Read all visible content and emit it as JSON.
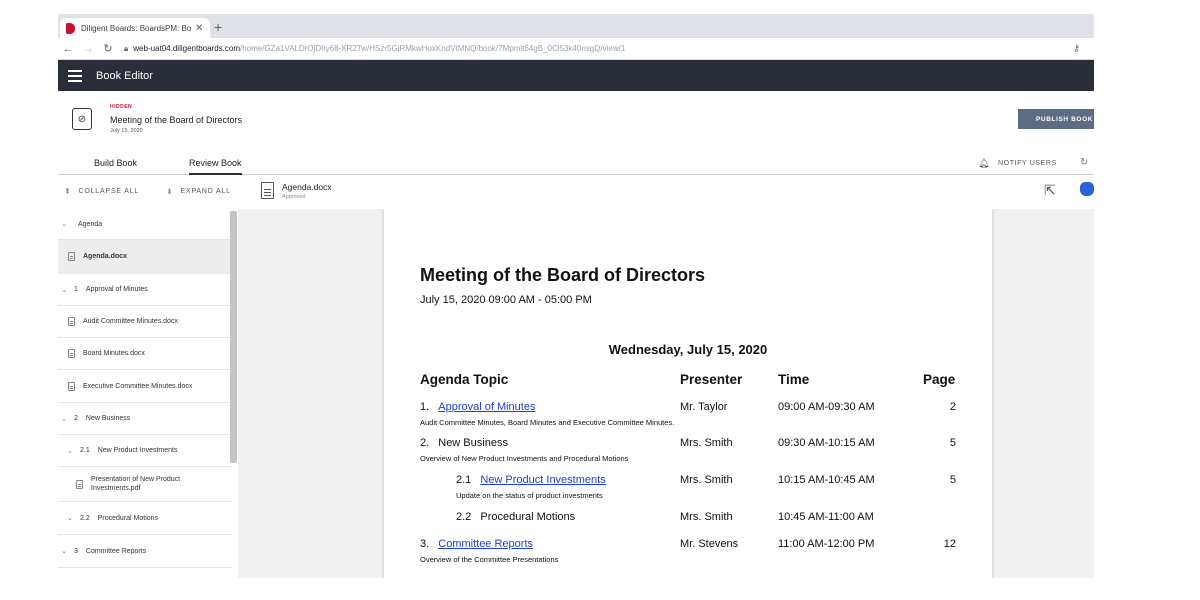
{
  "browser": {
    "tab_title": "Diligent Boards: BoardsPM: Book",
    "url_host": "web-uat04.diligentboards.com",
    "url_path": "/home/GZa1VALDrOjDhy68-XR2Tw/HSzr5GiRMkwHoxKndVtMNQ/book/7Mpmlt64gB_0Cl53k40nsgQ/view/1"
  },
  "app": {
    "title": "Book Editor"
  },
  "book": {
    "status": "HIDDEN",
    "title": "Meeting of the Board of Directors",
    "date": "July 15, 2020",
    "publish_label": "PUBLISH BOOK"
  },
  "tabs": [
    {
      "label": "Build Book",
      "active": false
    },
    {
      "label": "Review Book",
      "active": true
    }
  ],
  "notify_label": "NOTIFY USERS",
  "toolbar": {
    "collapse_label": "COLLAPSE ALL",
    "expand_label": "EXPAND ALL",
    "doc_name": "Agenda.docx",
    "doc_status": "Approved"
  },
  "sidebar": {
    "items": [
      {
        "kind": "section",
        "number": "",
        "label": "Agenda"
      },
      {
        "kind": "doc",
        "label": "Agenda.docx",
        "selected": true
      },
      {
        "kind": "section",
        "number": "1",
        "label": "Approval of Minutes"
      },
      {
        "kind": "doc",
        "label": "Audit Committee Minutes.docx"
      },
      {
        "kind": "doc",
        "label": "Board Minutes.docx"
      },
      {
        "kind": "doc",
        "label": "Executive Committee Minutes.docx"
      },
      {
        "kind": "section",
        "number": "2",
        "label": "New Business"
      },
      {
        "kind": "subsection",
        "number": "2.1",
        "label": "New Product Investments"
      },
      {
        "kind": "subdoc",
        "label": "Presentation of New Product Investments.pdf"
      },
      {
        "kind": "subsection",
        "number": "2.2",
        "label": "Procedural Motions"
      },
      {
        "kind": "section",
        "number": "3",
        "label": "Committee Reports"
      }
    ]
  },
  "document": {
    "title": "Meeting of the Board of Directors",
    "subtitle": "July 15, 2020 09:00 AM - 05:00 PM",
    "day_heading": "Wednesday, July 15, 2020",
    "headers": {
      "topic": "Agenda Topic",
      "presenter": "Presenter",
      "time": "Time",
      "page": "Page"
    },
    "rows": [
      {
        "num": "1.",
        "topic": "Approval of Minutes",
        "link": true,
        "desc": "Audit Committee Minutes, Board Minutes and Executive Committee Minutes.",
        "presenter": "Mr. Taylor",
        "time": "09:00 AM-09:30 AM",
        "page": "2"
      },
      {
        "num": "2.",
        "topic": "New Business",
        "link": false,
        "desc": "Overview of New Product Investments and Procedural Motions",
        "presenter": "Mrs. Smith",
        "time": "09:30 AM-10:15 AM",
        "page": "5"
      },
      {
        "num": "2.1",
        "topic": "New Product Investments",
        "link": true,
        "desc": "Update on the status of product investments",
        "presenter": "Mrs. Smith",
        "time": "10:15 AM-10:45 AM",
        "page": "5"
      },
      {
        "num": "2.2",
        "topic": "Procedural Motions",
        "link": false,
        "desc": "",
        "presenter": "Mrs. Smith",
        "time": "10:45 AM-11:00 AM",
        "page": ""
      },
      {
        "num": "3.",
        "topic": "Committee Reports",
        "link": true,
        "desc": "Overview of the Committee Presentations",
        "presenter": "Mr. Stevens",
        "time": "11:00 AM-12:00 PM",
        "page": "12"
      }
    ]
  }
}
